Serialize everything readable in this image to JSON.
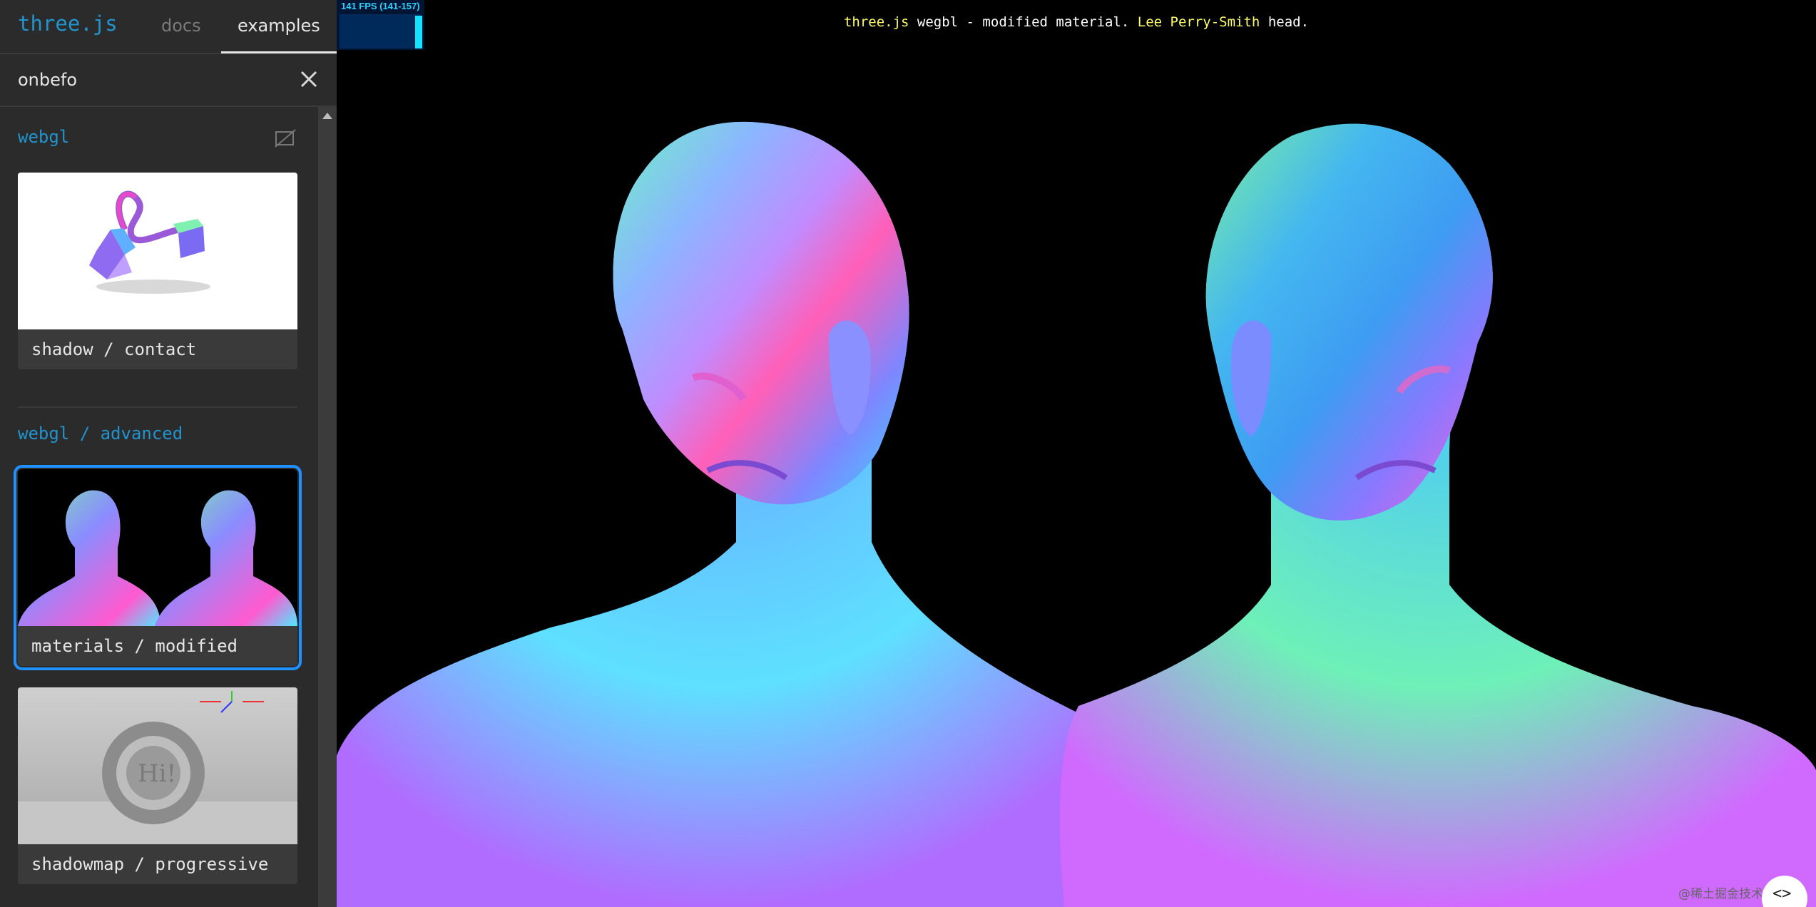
{
  "sidebar": {
    "brand": "three.js",
    "tabs": [
      {
        "label": "docs"
      },
      {
        "label": "examples"
      }
    ],
    "search": {
      "value": "onbefo"
    },
    "sections": [
      {
        "title": "webgl",
        "items": [
          {
            "label": "shadow / contact"
          }
        ]
      },
      {
        "title": "webgl / advanced",
        "items": [
          {
            "label": "materials / modified"
          },
          {
            "label": "shadowmap / progressive"
          }
        ]
      }
    ]
  },
  "viewport": {
    "fps": "141 FPS (141-157)",
    "info": {
      "part1": "three.js",
      "part2": " wegbl - modified material. ",
      "part3": "Lee Perry-Smith",
      "part4": " head."
    },
    "watermark": "@稀土掘金技术社区",
    "code_button": "<>"
  },
  "colors": {
    "accent": "#2194ce",
    "selected_outline": "#1e90ff",
    "sidebar_bg": "#2b2b2b"
  }
}
